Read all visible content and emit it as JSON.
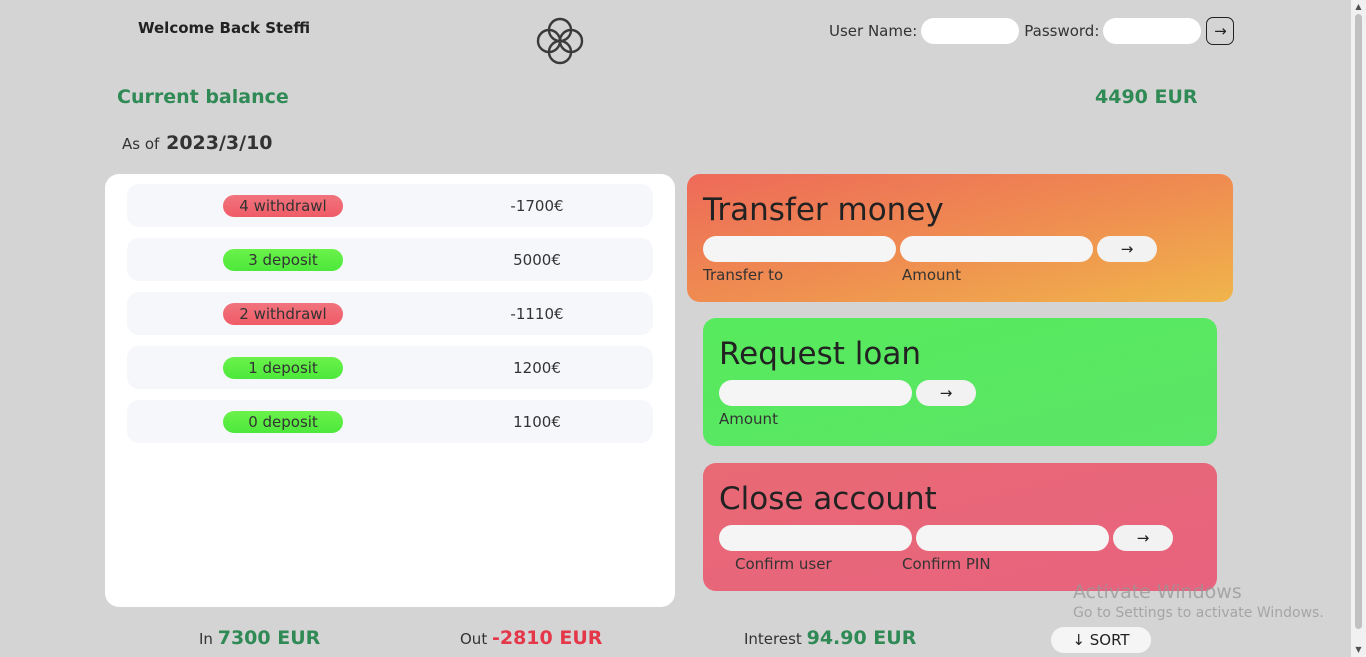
{
  "header": {
    "welcome": "Welcome Back Steffi",
    "username_label": "User Name:",
    "password_label": "Password:",
    "login_arrow": "→"
  },
  "balance": {
    "label": "Current balance",
    "as_of_label": "As of",
    "date": "2023/3/10",
    "value": "4490 EUR"
  },
  "movements": [
    {
      "type_label": "4 withdrawl",
      "kind": "withdrawal",
      "value": "-1700€"
    },
    {
      "type_label": "3 deposit",
      "kind": "deposit",
      "value": "5000€"
    },
    {
      "type_label": "2 withdrawl",
      "kind": "withdrawal",
      "value": "-1110€"
    },
    {
      "type_label": "1 deposit",
      "kind": "deposit",
      "value": "1200€"
    },
    {
      "type_label": "0 deposit",
      "kind": "deposit",
      "value": "1100€"
    }
  ],
  "transfer": {
    "title": "Transfer money",
    "to_label": "Transfer to",
    "amount_label": "Amount",
    "button": "→"
  },
  "loan": {
    "title": "Request loan",
    "amount_label": "Amount",
    "button": "→"
  },
  "close": {
    "title": "Close account",
    "user_label": "Confirm user",
    "pin_label": "Confirm PIN",
    "button": "→"
  },
  "summary": {
    "in_label": "In",
    "in_value": "7300 EUR",
    "out_label": "Out",
    "out_value": "-2810 EUR",
    "interest_label": "Interest",
    "interest_value": "94.90 EUR",
    "sort_button": "↓ SORT"
  },
  "watermark": {
    "line1": "Activate Windows",
    "line2": "Go to Settings to activate Windows."
  },
  "colors": {
    "background": "#d4d4d4",
    "green_text": "#2f8a55",
    "red_text": "#e4384a",
    "withdrawal_badge": "#ef5b66",
    "deposit_badge": "#4ce83b"
  },
  "icons": {
    "logo": "four-circles-logo-icon",
    "login": "arrow-right-icon",
    "sort": "arrow-down-icon"
  }
}
